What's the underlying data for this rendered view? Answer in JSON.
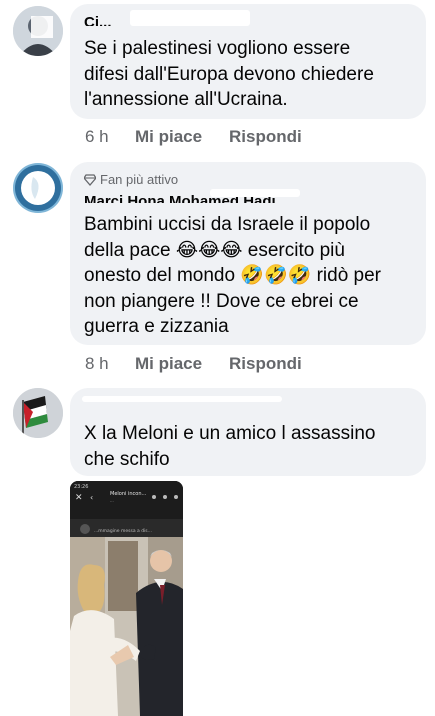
{
  "comments": [
    {
      "author": "Ci...",
      "text_lines": [
        "Se i palestinesi vogliono essere",
        "difesi dall'Europa devono chiedere",
        "l'annessione all'Ucraina."
      ],
      "time": "6 h",
      "like_label": "Mi piace",
      "reply_label": "Rispondi"
    },
    {
      "badge": "Fan più attivo",
      "author": "Marci Hona Mohamed Hadi",
      "text_lines": [
        "Bambini uccisi da Israele il popolo",
        "della pace 😂😂😂 esercito più",
        "onesto del mondo 🤣🤣🤣 ridò per",
        "non piangere !! Dove ce ebrei ce",
        "guerra e zizzania"
      ],
      "time": "8 h",
      "like_label": "Mi piace",
      "reply_label": "Rispondi"
    },
    {
      "author": "...",
      "text_lines": [
        "X la Meloni e un amico l assassino",
        "che schifo"
      ],
      "attachment": {
        "title": "Meloni incon...",
        "subtitle": "...",
        "caption": "...mmagine messa a dis..."
      }
    }
  ],
  "colors": {
    "bubble": "#f0f2f5",
    "meta_text": "#65676b",
    "text": "#050505"
  }
}
